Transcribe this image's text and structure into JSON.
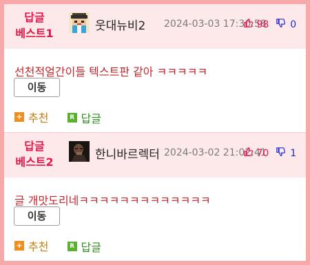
{
  "comments": [
    {
      "rank_line1": "답글",
      "rank_line2": "베스트1",
      "avatar": "pixel-character-avatar",
      "username": "웃대뉴비2",
      "date": "2024-03-03 17:30:58",
      "upvotes": "98",
      "downvotes": "0",
      "content": "선천적얼간이들 텍스트판 같아 ㅋㅋㅋㅋㅋ",
      "move_label": "이동",
      "recommend_label": "추천",
      "reply_label": "답글"
    },
    {
      "rank_line1": "답글",
      "rank_line2": "베스트2",
      "avatar": "dark-photo-avatar",
      "username": "한니바르렉터",
      "date": "2024-03-02 21:02:41",
      "upvotes": "70",
      "downvotes": "1",
      "content": "글 개맛도리네ㅋㅋㅋㅋㅋㅋㅋㅋㅋㅋㅋㅋㅋ",
      "move_label": "이동",
      "recommend_label": "추천",
      "reply_label": "답글"
    }
  ],
  "colors": {
    "frame": "#f7a9a9",
    "header_bg": "#fde8ea",
    "rank": "#e4174b",
    "content": "#c0272d",
    "recommend": "#c77b0b",
    "reply": "#2e8b1e",
    "downvote": "#1e2bd3"
  }
}
